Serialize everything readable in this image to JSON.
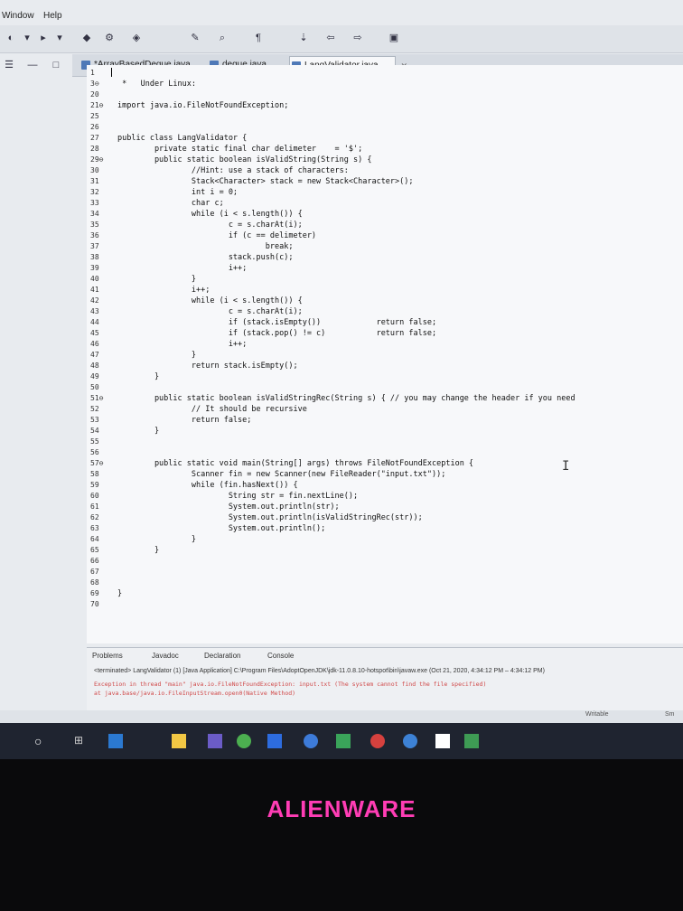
{
  "menu": {
    "items": [
      "Window",
      "Help"
    ]
  },
  "editor_tabs": [
    {
      "label": "*ArrayBasedDeque.java",
      "active": false
    },
    {
      "label": "deque.java",
      "active": false
    },
    {
      "label": "LangValidator.java",
      "active": true
    }
  ],
  "close_tab_glyph": "✕",
  "line_numbers": [
    "1",
    "3⊖",
    "20",
    "21⊖",
    "25",
    "26",
    "27",
    "28",
    "29⊖",
    "30",
    "31",
    "32",
    "33",
    "34",
    "35",
    "36",
    "37",
    "38",
    "39",
    "40",
    "41",
    "42",
    "43",
    "44",
    "45",
    "46",
    "47",
    "48",
    "49",
    "50",
    "51⊖",
    "52",
    "53",
    "54",
    "55",
    "56",
    "57⊖",
    "58",
    "59",
    "60",
    "61",
    "62",
    "63",
    "64",
    "65",
    "66",
    "67",
    "68",
    "69",
    "70"
  ],
  "code_lines": [
    "",
    " *   Under Linux:",
    "",
    "import java.io.FileNotFoundException;",
    "",
    "",
    "public class LangValidator {",
    "        private static final char delimeter    = '$';",
    "        public static boolean isValidString(String s) {",
    "                //Hint: use a stack of characters:",
    "                Stack<Character> stack = new Stack<Character>();",
    "                int i = 0;",
    "                char c;",
    "                while (i < s.length()) {",
    "                        c = s.charAt(i);",
    "                        if (c == delimeter)",
    "                                break;",
    "                        stack.push(c);",
    "                        i++;",
    "                }",
    "                i++;",
    "                while (i < s.length()) {",
    "                        c = s.charAt(i);",
    "                        if (stack.isEmpty())            return false;",
    "                        if (stack.pop() != c)           return false;",
    "                        i++;",
    "                }",
    "                return stack.isEmpty();",
    "        }",
    "",
    "        public static boolean isValidStringRec(String s) { // you may change the header if you need",
    "                // It should be recursive",
    "                return false;",
    "        }",
    "",
    "",
    "        public static void main(String[] args) throws FileNotFoundException {",
    "                Scanner fin = new Scanner(new FileReader(\"input.txt\"));",
    "                while (fin.hasNext()) {",
    "                        String str = fin.nextLine();",
    "                        System.out.println(str);",
    "                        System.out.println(isValidStringRec(str));",
    "                        System.out.println();",
    "                }",
    "        }",
    "",
    "",
    "",
    "}",
    ""
  ],
  "console": {
    "tabs": [
      "Problems",
      "Javadoc",
      "Declaration",
      "Console"
    ],
    "terminated": "<terminated> LangValidator (1) [Java Application] C:\\Program Files\\AdoptOpenJDK\\jdk-11.0.8.10-hotspot\\bin\\javaw.exe (Oct 21, 2020, 4:34:12 PM – 4:34:12 PM)",
    "error_line1": "Exception in thread \"main\" java.io.FileNotFoundException: input.txt (The system cannot find the file specified)",
    "error_line2": "        at java.base/java.io.FileInputStream.open0(Native Method)"
  },
  "status_bar": {
    "writable": "Writable",
    "insert": "Sm"
  },
  "brand": "ALIENWARE",
  "colors": {
    "brand": "#ff3db5",
    "error": "#d04848",
    "editor_bg": "#f7f8fa"
  }
}
